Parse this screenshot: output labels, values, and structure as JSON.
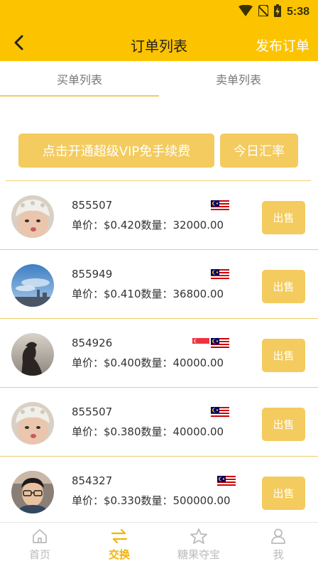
{
  "status_bar": {
    "time": "5:38"
  },
  "header": {
    "title": "订单列表",
    "publish_label": "发布订单"
  },
  "tabs": [
    {
      "label": "买单列表",
      "active": true
    },
    {
      "label": "卖单列表",
      "active": false
    }
  ],
  "actions": {
    "vip_label": "点击开通超级VIP免手续费",
    "rate_label": "今日汇率"
  },
  "orders": [
    {
      "id": "855507",
      "detail": "单价：$0.420数量：32000.00",
      "sell_label": "出售",
      "flags": [
        "malaysia-flag-icon"
      ],
      "avatar": "baby-avatar"
    },
    {
      "id": "855949",
      "detail": "单价：$0.410数量：36800.00",
      "sell_label": "出售",
      "flags": [
        "malaysia-flag-icon"
      ],
      "avatar": "sky-avatar"
    },
    {
      "id": "854926",
      "detail": "单价：$0.400数量：40000.00",
      "sell_label": "出售",
      "flags": [
        "singapore-flag-icon",
        "malaysia-flag-icon"
      ],
      "avatar": "silhouette-avatar"
    },
    {
      "id": "855507",
      "detail": "单价：$0.380数量：40000.00",
      "sell_label": "出售",
      "flags": [
        "malaysia-flag-icon"
      ],
      "avatar": "baby-avatar"
    },
    {
      "id": "854327",
      "detail": "单价：$0.330数量：500000.00",
      "sell_label": "出售",
      "flags": [
        "malaysia-flag-icon"
      ],
      "avatar": "man-glasses-avatar"
    }
  ],
  "bottom_nav": [
    {
      "label": "首页",
      "icon": "home-icon",
      "active": false
    },
    {
      "label": "交换",
      "icon": "exchange-icon",
      "active": true
    },
    {
      "label": "糖果夺宝",
      "icon": "star-icon",
      "active": false
    },
    {
      "label": "我",
      "icon": "person-icon",
      "active": false
    }
  ],
  "colors": {
    "primary": "#fcc300",
    "button": "#f3cb5e",
    "divider": "#f0cd6a",
    "nav_active": "#f3b400",
    "nav_inactive": "#bbbbbb"
  }
}
